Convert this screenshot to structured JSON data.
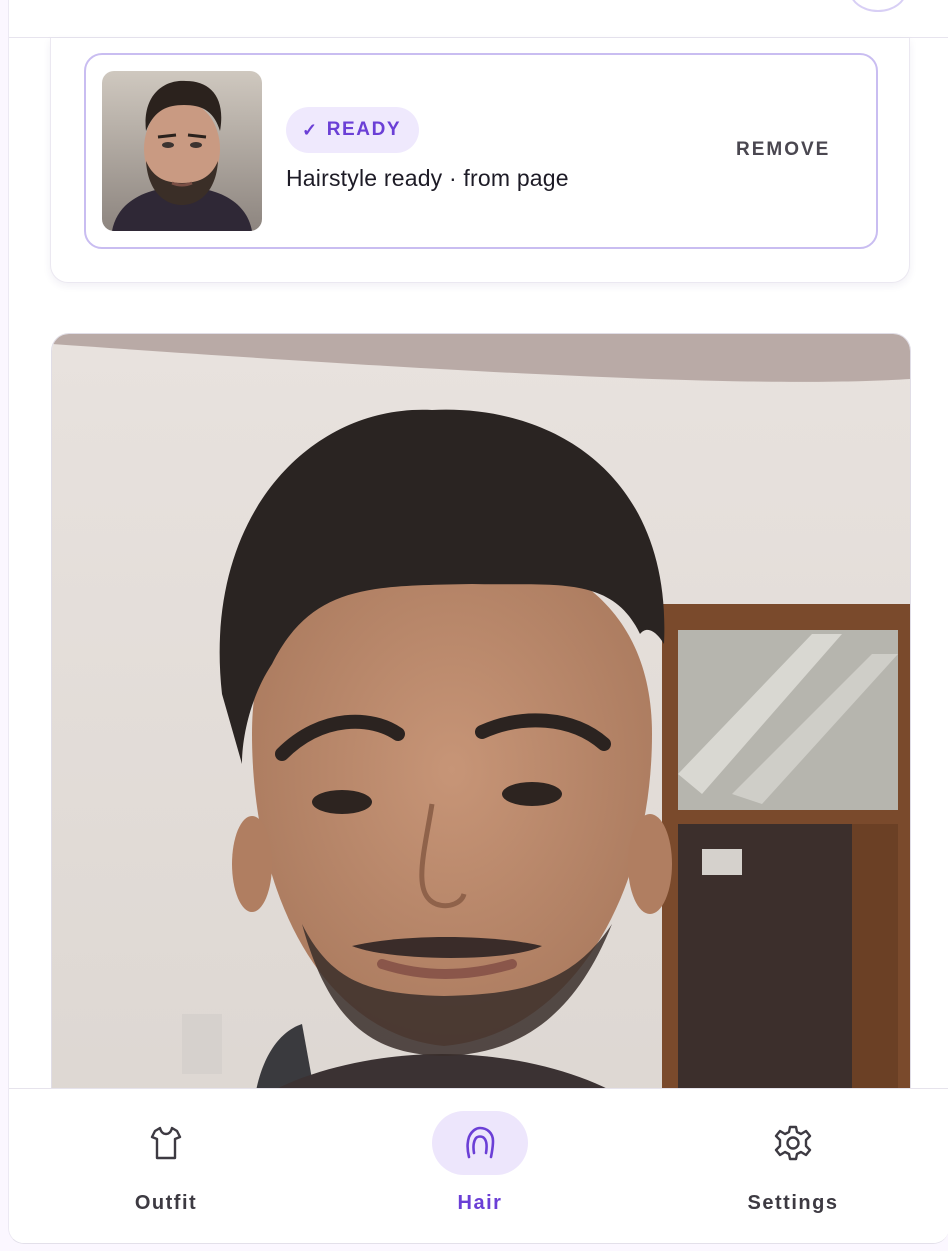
{
  "hairstyle_card": {
    "badge_label": "READY",
    "status_text": "Hairstyle ready · from page",
    "remove_label": "REMOVE"
  },
  "bottom_nav": {
    "items": [
      {
        "label": "Outfit",
        "icon": "shirt-icon",
        "active": false
      },
      {
        "label": "Hair",
        "icon": "hair-icon",
        "active": true
      },
      {
        "label": "Settings",
        "icon": "gear-icon",
        "active": false
      }
    ]
  },
  "colors": {
    "accent": "#6b3fd6",
    "badge_bg": "#efe9fd",
    "card_border": "#c9bdf1",
    "nav_active_bg": "#ede6fc",
    "page_bg": "#fbf7ff"
  }
}
